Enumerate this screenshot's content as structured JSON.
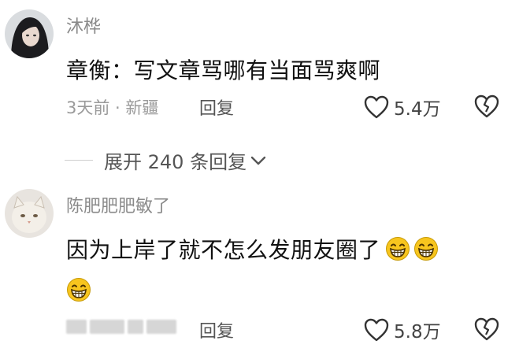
{
  "comments": [
    {
      "username": "沐桦",
      "content": "章衡：写文章骂哪有当面骂爽啊",
      "meta": "3天前 · 新疆",
      "reply_label": "回复",
      "like_count": "5.4万"
    },
    {
      "username": "陈肥肥肥敏了",
      "content": "因为上岸了就不怎么发朋友圈了",
      "reply_label": "回复",
      "like_count": "5.8万",
      "emoji": [
        "grinning-face",
        "grinning-face",
        "grinning-face"
      ]
    }
  ],
  "expand": {
    "label": "展开 240 条回复"
  },
  "icons": {
    "like": "heart-outline-icon",
    "dislike": "broken-heart-icon",
    "expand": "chevron-down-icon"
  },
  "colors": {
    "text_primary": "#111111",
    "text_secondary": "#8a8a8a",
    "emoji_yellow": "#f7c51e"
  }
}
